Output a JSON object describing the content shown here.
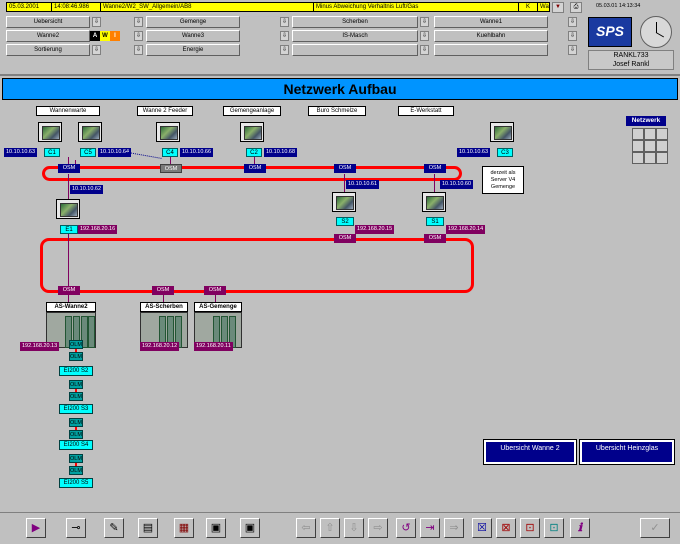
{
  "header": {
    "alarm": {
      "date": "05.03.2001",
      "time": "14:08:46.986",
      "source": "Wanne2/W2_SW_Allgemein/AB8",
      "message": "Minus Abweichung Verhaltnis Luft/Gas",
      "code": "K",
      "level": "Warning"
    },
    "nav_col1": [
      "Uebersicht",
      "Wanne2",
      "Sortierung"
    ],
    "nav_col2": [
      "Gemenge",
      "Wanne3",
      "Energie"
    ],
    "nav_col3": [
      "Scherben",
      "IS-Masch",
      ""
    ],
    "nav_col4": [
      "Wanne1",
      "Kuehlbahn",
      ""
    ],
    "status_letters": [
      "A",
      "W",
      "I"
    ],
    "logo_text": "SPS",
    "clock_datetime": "05.03.01 14:13:34",
    "station": "RANKL733",
    "user": "Josef Rankl"
  },
  "title": "Netzwerk Aufbau",
  "areas": [
    "Wannenwarte",
    "Wanne 2 Feeder",
    "Gemengeanlage",
    "Buro Schmelze",
    "E-Werkstatt"
  ],
  "nodes": {
    "c1": "C1",
    "c5": "C5",
    "c4": "C4",
    "c2": "C2",
    "c3": "C3",
    "e1": "E1",
    "s2": "S2",
    "s1": "S1"
  },
  "ips": {
    "c1": "10.10.10.63",
    "c5": "10.10.10.64",
    "c4": "10.10.10.66",
    "c2": "10.10.10.68",
    "c3": "10.10.10.63",
    "e1_top": "10.10.10.62",
    "e1": "192.168.20.16",
    "s2_top": "10.10.10.61",
    "s2": "192.168.20.15",
    "s1_top": "10.10.10.60",
    "s1": "192.168.20.14",
    "as_wanne2": "192.168.20.13",
    "as_scherben": "192.168.20.12",
    "as_gemenge": "192.168.20.11"
  },
  "osm_label": "OSM",
  "olm_label": "OLM",
  "plcs": [
    "AS-Wanne2",
    "AS-Scherben",
    "AS-Gemenge"
  ],
  "chain": [
    "EI200 S2",
    "EI200 S3",
    "EI200 S4",
    "EI200 S5"
  ],
  "note": "derzeit als Server V4 Gemenge",
  "netzwerk_label": "Netzwerk",
  "overview_buttons": [
    "Ubersicht Wanne 2",
    "Ubersicht Heinzglas"
  ],
  "toolbar": [
    "▶",
    "⊸",
    "✎",
    "▤",
    "▦",
    "▣",
    "⇦",
    "⇧",
    "⇩",
    "⇨",
    "↺",
    "⇥",
    "⇒",
    "☒",
    "⊠",
    "⊡",
    "ℹ",
    "✓"
  ]
}
